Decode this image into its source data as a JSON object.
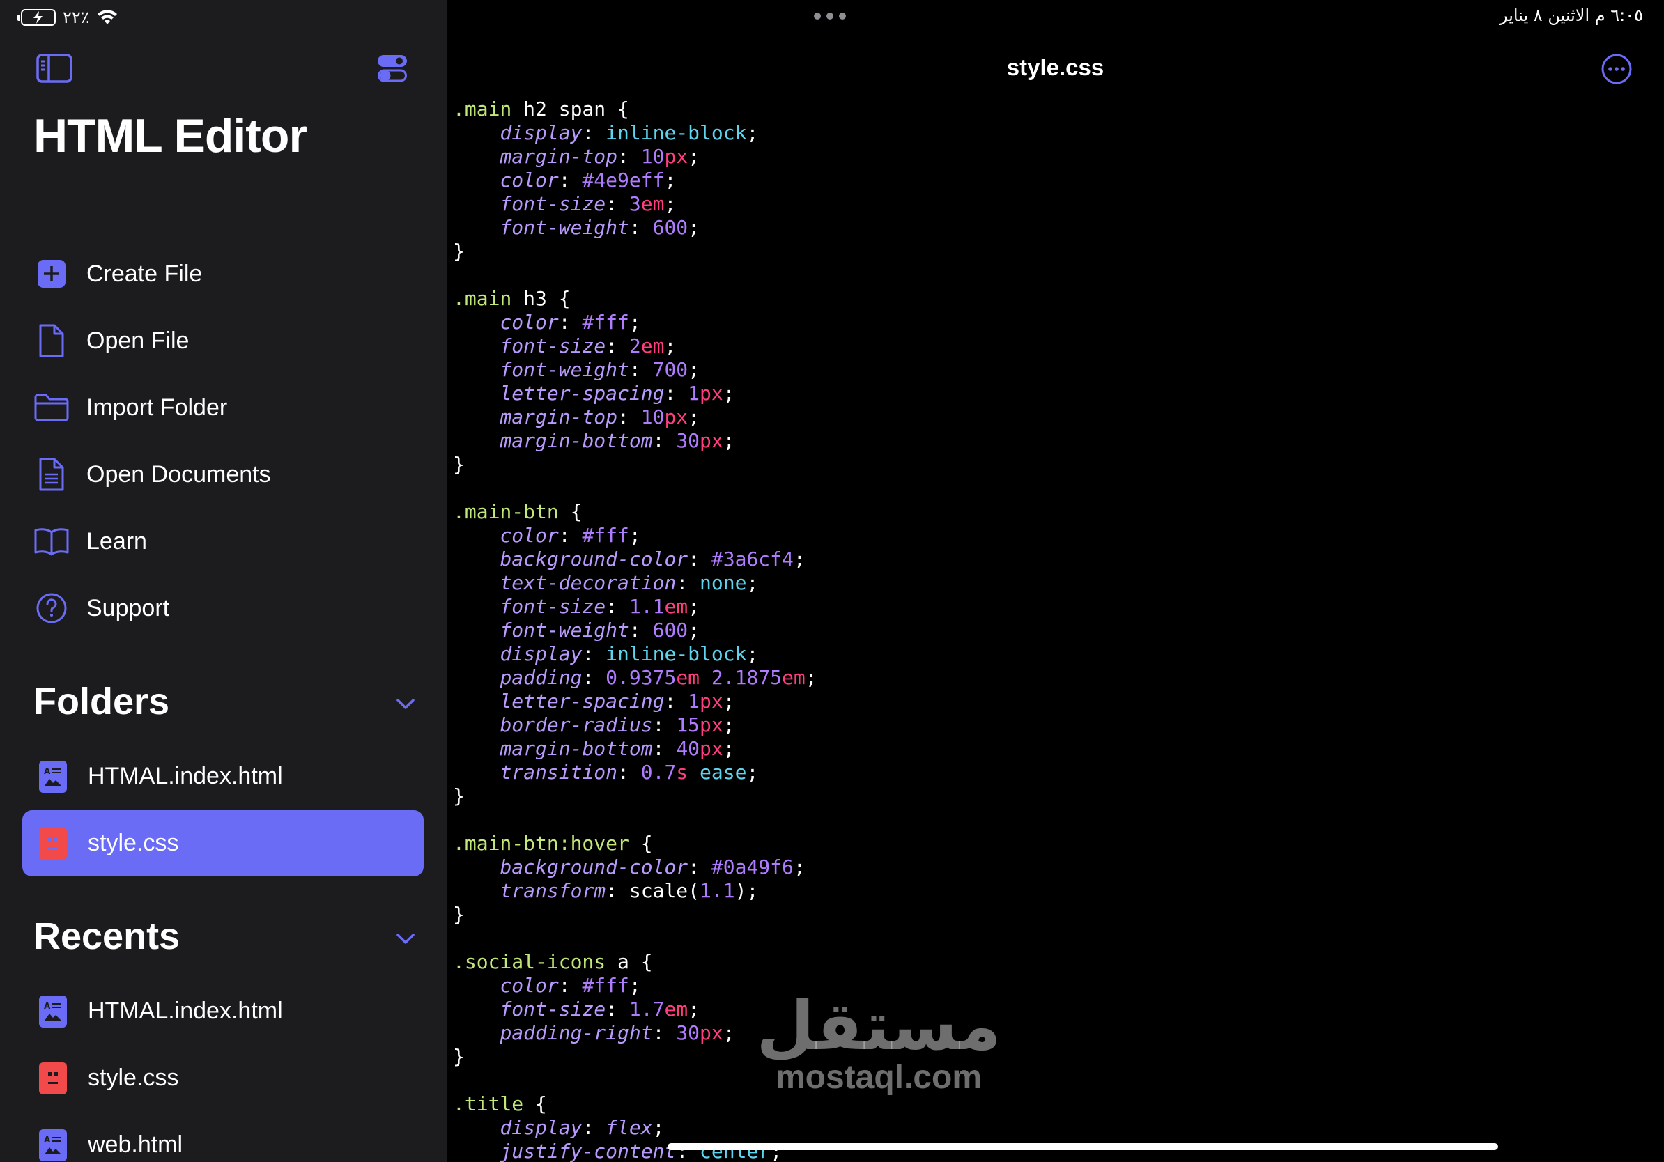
{
  "status_bar": {
    "battery_percent": "٢٢٪",
    "time_date": "٦:٠٥ م   الاثنين ٨ يناير"
  },
  "sidebar": {
    "title": "HTML Editor",
    "menu": [
      {
        "label": "Create File",
        "icon": "plus-square-icon"
      },
      {
        "label": "Open File",
        "icon": "document-icon"
      },
      {
        "label": "Import Folder",
        "icon": "folder-icon"
      },
      {
        "label": "Open Documents",
        "icon": "documents-icon"
      },
      {
        "label": "Learn",
        "icon": "book-icon"
      },
      {
        "label": "Support",
        "icon": "question-circle-icon"
      }
    ],
    "folders": {
      "title": "Folders",
      "items": [
        {
          "label": "HTMAL.index.html",
          "type": "html",
          "selected": false
        },
        {
          "label": "style.css",
          "type": "css",
          "selected": true
        }
      ]
    },
    "recents": {
      "title": "Recents",
      "items": [
        {
          "label": "HTMAL.index.html",
          "type": "html"
        },
        {
          "label": "style.css",
          "type": "css"
        },
        {
          "label": "web.html",
          "type": "html"
        }
      ]
    }
  },
  "editor": {
    "file_title": "style.css",
    "code_lines": [
      [
        [
          "sel",
          ".main"
        ],
        [
          "pun",
          " h2 span {"
        ]
      ],
      [
        [
          "pun",
          "    "
        ],
        [
          "prop",
          "display"
        ],
        [
          "pun",
          ": "
        ],
        [
          "val",
          "inline-block"
        ],
        [
          "pun",
          ";"
        ]
      ],
      [
        [
          "pun",
          "    "
        ],
        [
          "prop",
          "margin-top"
        ],
        [
          "pun",
          ": "
        ],
        [
          "num",
          "10"
        ],
        [
          "unit",
          "px"
        ],
        [
          "pun",
          ";"
        ]
      ],
      [
        [
          "pun",
          "    "
        ],
        [
          "prop",
          "color"
        ],
        [
          "pun",
          ": "
        ],
        [
          "hex",
          "#4e9eff"
        ],
        [
          "pun",
          ";"
        ]
      ],
      [
        [
          "pun",
          "    "
        ],
        [
          "prop",
          "font-size"
        ],
        [
          "pun",
          ": "
        ],
        [
          "num",
          "3"
        ],
        [
          "unit",
          "em"
        ],
        [
          "pun",
          ";"
        ]
      ],
      [
        [
          "pun",
          "    "
        ],
        [
          "prop",
          "font-weight"
        ],
        [
          "pun",
          ": "
        ],
        [
          "num",
          "600"
        ],
        [
          "pun",
          ";"
        ]
      ],
      [
        [
          "pun",
          "}"
        ]
      ],
      [
        [
          "pun",
          ""
        ]
      ],
      [
        [
          "sel",
          ".main"
        ],
        [
          "pun",
          " h3 {"
        ]
      ],
      [
        [
          "pun",
          "    "
        ],
        [
          "prop",
          "color"
        ],
        [
          "pun",
          ": "
        ],
        [
          "hex",
          "#fff"
        ],
        [
          "pun",
          ";"
        ]
      ],
      [
        [
          "pun",
          "    "
        ],
        [
          "prop",
          "font-size"
        ],
        [
          "pun",
          ": "
        ],
        [
          "num",
          "2"
        ],
        [
          "unit",
          "em"
        ],
        [
          "pun",
          ";"
        ]
      ],
      [
        [
          "pun",
          "    "
        ],
        [
          "prop",
          "font-weight"
        ],
        [
          "pun",
          ": "
        ],
        [
          "num",
          "700"
        ],
        [
          "pun",
          ";"
        ]
      ],
      [
        [
          "pun",
          "    "
        ],
        [
          "prop",
          "letter-spacing"
        ],
        [
          "pun",
          ": "
        ],
        [
          "num",
          "1"
        ],
        [
          "unit",
          "px"
        ],
        [
          "pun",
          ";"
        ]
      ],
      [
        [
          "pun",
          "    "
        ],
        [
          "prop",
          "margin-top"
        ],
        [
          "pun",
          ": "
        ],
        [
          "num",
          "10"
        ],
        [
          "unit",
          "px"
        ],
        [
          "pun",
          ";"
        ]
      ],
      [
        [
          "pun",
          "    "
        ],
        [
          "prop",
          "margin-bottom"
        ],
        [
          "pun",
          ": "
        ],
        [
          "num",
          "30"
        ],
        [
          "unit",
          "px"
        ],
        [
          "pun",
          ";"
        ]
      ],
      [
        [
          "pun",
          "}"
        ]
      ],
      [
        [
          "pun",
          ""
        ]
      ],
      [
        [
          "sel",
          ".main-btn"
        ],
        [
          "pun",
          " {"
        ]
      ],
      [
        [
          "pun",
          "    "
        ],
        [
          "prop",
          "color"
        ],
        [
          "pun",
          ": "
        ],
        [
          "hex",
          "#fff"
        ],
        [
          "pun",
          ";"
        ]
      ],
      [
        [
          "pun",
          "    "
        ],
        [
          "prop",
          "background-color"
        ],
        [
          "pun",
          ": "
        ],
        [
          "hex",
          "#3a6cf4"
        ],
        [
          "pun",
          ";"
        ]
      ],
      [
        [
          "pun",
          "    "
        ],
        [
          "prop",
          "text-decoration"
        ],
        [
          "pun",
          ": "
        ],
        [
          "val",
          "none"
        ],
        [
          "pun",
          ";"
        ]
      ],
      [
        [
          "pun",
          "    "
        ],
        [
          "prop",
          "font-size"
        ],
        [
          "pun",
          ": "
        ],
        [
          "num",
          "1.1"
        ],
        [
          "unit",
          "em"
        ],
        [
          "pun",
          ";"
        ]
      ],
      [
        [
          "pun",
          "    "
        ],
        [
          "prop",
          "font-weight"
        ],
        [
          "pun",
          ": "
        ],
        [
          "num",
          "600"
        ],
        [
          "pun",
          ";"
        ]
      ],
      [
        [
          "pun",
          "    "
        ],
        [
          "prop",
          "display"
        ],
        [
          "pun",
          ": "
        ],
        [
          "val",
          "inline-block"
        ],
        [
          "pun",
          ";"
        ]
      ],
      [
        [
          "pun",
          "    "
        ],
        [
          "prop",
          "padding"
        ],
        [
          "pun",
          ": "
        ],
        [
          "num",
          "0.9375"
        ],
        [
          "unit",
          "em"
        ],
        [
          "pun",
          " "
        ],
        [
          "num",
          "2.1875"
        ],
        [
          "unit",
          "em"
        ],
        [
          "pun",
          ";"
        ]
      ],
      [
        [
          "pun",
          "    "
        ],
        [
          "prop",
          "letter-spacing"
        ],
        [
          "pun",
          ": "
        ],
        [
          "num",
          "1"
        ],
        [
          "unit",
          "px"
        ],
        [
          "pun",
          ";"
        ]
      ],
      [
        [
          "pun",
          "    "
        ],
        [
          "prop",
          "border-radius"
        ],
        [
          "pun",
          ": "
        ],
        [
          "num",
          "15"
        ],
        [
          "unit",
          "px"
        ],
        [
          "pun",
          ";"
        ]
      ],
      [
        [
          "pun",
          "    "
        ],
        [
          "prop",
          "margin-bottom"
        ],
        [
          "pun",
          ": "
        ],
        [
          "num",
          "40"
        ],
        [
          "unit",
          "px"
        ],
        [
          "pun",
          ";"
        ]
      ],
      [
        [
          "pun",
          "    "
        ],
        [
          "prop",
          "transition"
        ],
        [
          "pun",
          ": "
        ],
        [
          "num",
          "0.7"
        ],
        [
          "unit",
          "s"
        ],
        [
          "pun",
          " "
        ],
        [
          "val",
          "ease"
        ],
        [
          "pun",
          ";"
        ]
      ],
      [
        [
          "pun",
          "}"
        ]
      ],
      [
        [
          "pun",
          ""
        ]
      ],
      [
        [
          "sel",
          ".main-btn"
        ],
        [
          "pseudo",
          ":hover"
        ],
        [
          "pun",
          " {"
        ]
      ],
      [
        [
          "pun",
          "    "
        ],
        [
          "prop",
          "background-color"
        ],
        [
          "pun",
          ": "
        ],
        [
          "hex",
          "#0a49f6"
        ],
        [
          "pun",
          ";"
        ]
      ],
      [
        [
          "pun",
          "    "
        ],
        [
          "prop",
          "transform"
        ],
        [
          "pun",
          ": "
        ],
        [
          "fn",
          "scale("
        ],
        [
          "num",
          "1.1"
        ],
        [
          "fn",
          ")"
        ],
        [
          "pun",
          ";"
        ]
      ],
      [
        [
          "pun",
          "}"
        ]
      ],
      [
        [
          "pun",
          ""
        ]
      ],
      [
        [
          "sel",
          ".social-icons"
        ],
        [
          "pun",
          " a {"
        ]
      ],
      [
        [
          "pun",
          "    "
        ],
        [
          "prop",
          "color"
        ],
        [
          "pun",
          ": "
        ],
        [
          "hex",
          "#fff"
        ],
        [
          "pun",
          ";"
        ]
      ],
      [
        [
          "pun",
          "    "
        ],
        [
          "prop",
          "font-size"
        ],
        [
          "pun",
          ": "
        ],
        [
          "num",
          "1.7"
        ],
        [
          "unit",
          "em"
        ],
        [
          "pun",
          ";"
        ]
      ],
      [
        [
          "pun",
          "    "
        ],
        [
          "prop",
          "padding-right"
        ],
        [
          "pun",
          ": "
        ],
        [
          "num",
          "30"
        ],
        [
          "unit",
          "px"
        ],
        [
          "pun",
          ";"
        ]
      ],
      [
        [
          "pun",
          "}"
        ]
      ],
      [
        [
          "pun",
          ""
        ]
      ],
      [
        [
          "sel",
          ".title"
        ],
        [
          "pun",
          " {"
        ]
      ],
      [
        [
          "pun",
          "    "
        ],
        [
          "prop",
          "display"
        ],
        [
          "pun",
          ": "
        ],
        [
          "prop",
          "flex"
        ],
        [
          "pun",
          ";"
        ]
      ],
      [
        [
          "pun",
          "    "
        ],
        [
          "prop",
          "justify-content"
        ],
        [
          "pun",
          ": "
        ],
        [
          "val",
          "center"
        ],
        [
          "pun",
          ";"
        ]
      ]
    ]
  },
  "watermark": {
    "arabic": "مستقل",
    "latin": "mostaql.com"
  },
  "colors": {
    "sidebar_bg": "#1c1c1e",
    "accent": "#6b6cf6",
    "selector": "#c1e879",
    "property": "#b89afc",
    "keyword_value": "#5ed4ef",
    "number": "#b07cff",
    "unit": "#ff3d7f",
    "css_file_icon": "#f24a4a",
    "html_file_icon": "#6b6cf6"
  }
}
